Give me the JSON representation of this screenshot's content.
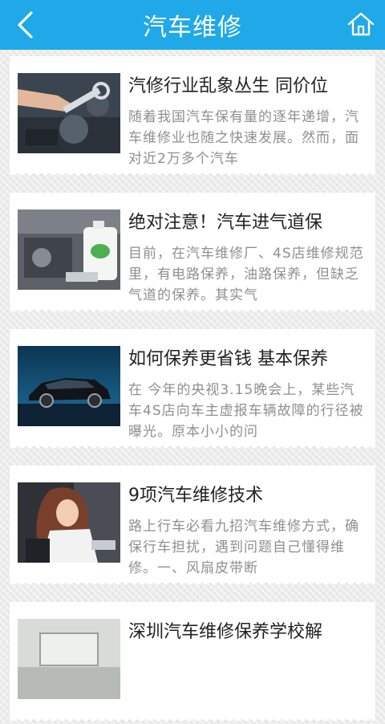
{
  "header": {
    "title": "汽车维修",
    "back_icon": "back-arrow-icon",
    "home_icon": "home-icon",
    "bg_color": "#1fa9e8"
  },
  "articles": [
    {
      "title": "汽修行业乱象丛生 同价位",
      "desc": "随着我国汽车保有量的逐年递增，汽车维修业也随之快速发展。然而，面对近2万多个汽车"
    },
    {
      "title": "绝对注意！汽车进气道保",
      "desc": "目前，在汽车维修厂、4S店维修规范里，有电路保养，油路保养，但缺乏气道的保养。其实气"
    },
    {
      "title": "如何保养更省钱 基本保养",
      "desc": "在 今年的央视3.15晚会上，某些汽车4S店向车主虚报车辆故障的行径被曝光。原本小小的问"
    },
    {
      "title": "9项汽车维修技术",
      "desc": "路上行车必看九招汽车维修方式，确保行车担扰，遇到问题自己懂得维修。一、风扇皮带断"
    },
    {
      "title": "深圳汽车维修保养学校解",
      "desc": ""
    }
  ]
}
